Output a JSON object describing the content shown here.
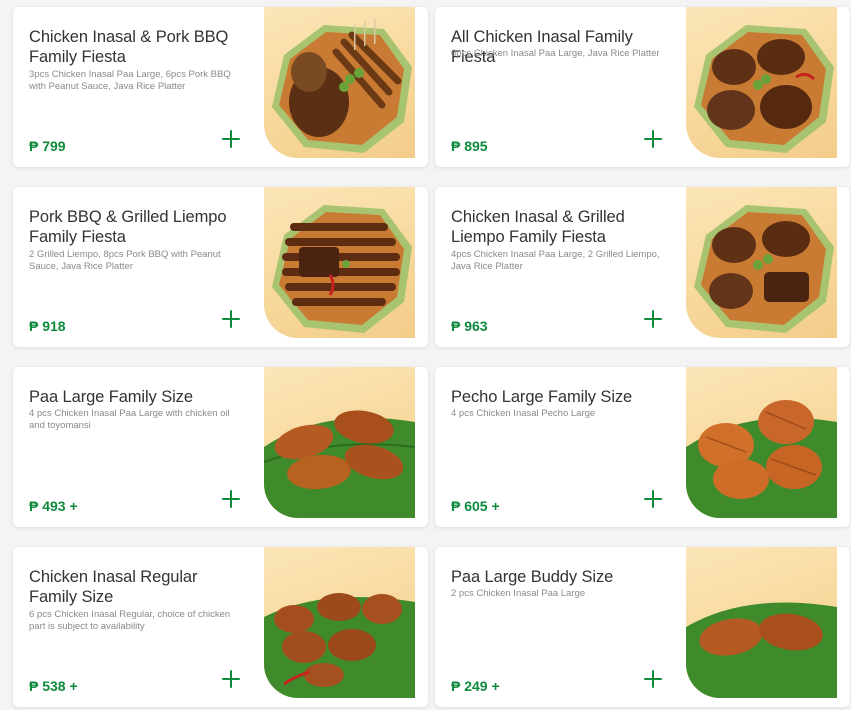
{
  "currency": "₱",
  "items": [
    {
      "title": "Chicken Inasal & Pork BBQ Family Fiesta",
      "description": "3pcs Chicken Inasal Paa Large, 6pcs Pork BBQ with Peanut Sauce, Java Rice Platter",
      "price": "₱ 799",
      "image": "chicken-pork-bbq-platter"
    },
    {
      "title": "All Chicken Inasal Family Fiesta",
      "description": "6pcs Chicken Inasal Paa Large, Java Rice Platter",
      "price": "₱ 895",
      "image": "all-chicken-platter"
    },
    {
      "title": "Pork BBQ & Grilled Liempo Family Fiesta",
      "description": "2 Grilled Liempo, 8pcs Pork BBQ with Peanut Sauce, Java Rice Platter",
      "price": "₱ 918",
      "image": "pork-bbq-liempo-platter"
    },
    {
      "title": "Chicken Inasal & Grilled Liempo Family Fiesta",
      "description": "4pcs Chicken Inasal Paa Large, 2 Grilled Liempo, Java Rice Platter",
      "price": "₱ 963",
      "image": "chicken-liempo-platter"
    },
    {
      "title": "Paa Large Family Size",
      "description": "4 pcs Chicken Inasal Paa Large with chicken oil and toyomansi",
      "price": "₱ 493 +",
      "image": "paa-large-on-leaf"
    },
    {
      "title": "Pecho Large Family Size",
      "description": "4 pcs Chicken Inasal Pecho Large",
      "price": "₱ 605 +",
      "image": "pecho-large-on-leaf"
    },
    {
      "title": "Chicken Inasal Regular Family Size",
      "description": "6 pcs Chicken Inasal Regular, choice of chicken part is subject to availability",
      "price": "₱ 538 +",
      "image": "regular-chicken-on-leaf"
    },
    {
      "title": "Paa Large Buddy Size",
      "description": "2 pcs Chicken Inasal Paa Large",
      "price": "₱ 249 +",
      "image": "paa-buddy-on-leaf"
    }
  ],
  "colors": {
    "accent": "#0e8a3c",
    "image_bg": "#f7d79a",
    "card_bg": "#ffffff",
    "page_bg": "#f4f4f4"
  }
}
